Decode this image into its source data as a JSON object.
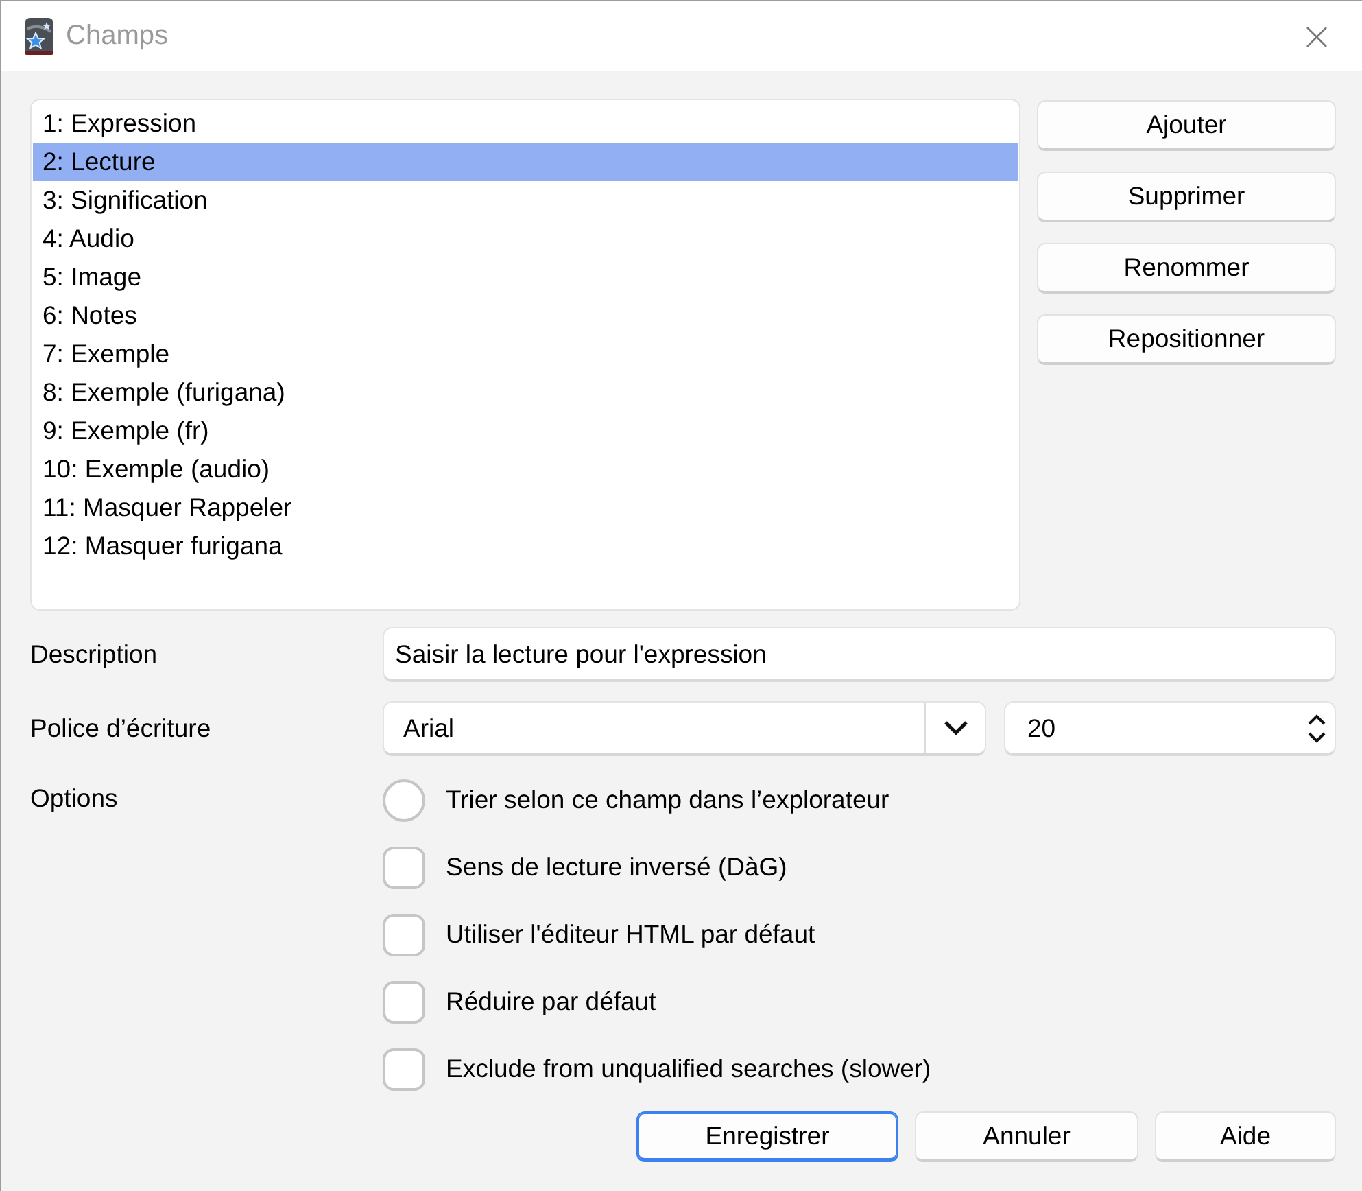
{
  "window": {
    "title": "Champs"
  },
  "fields": {
    "items": [
      {
        "label": "1: Expression",
        "selected": false
      },
      {
        "label": "2: Lecture",
        "selected": true
      },
      {
        "label": "3: Signification",
        "selected": false
      },
      {
        "label": "4: Audio",
        "selected": false
      },
      {
        "label": "5: Image",
        "selected": false
      },
      {
        "label": "6: Notes",
        "selected": false
      },
      {
        "label": "7: Exemple",
        "selected": false
      },
      {
        "label": "8: Exemple (furigana)",
        "selected": false
      },
      {
        "label": "9: Exemple (fr)",
        "selected": false
      },
      {
        "label": "10: Exemple (audio)",
        "selected": false
      },
      {
        "label": "11: Masquer Rappeler",
        "selected": false
      },
      {
        "label": "12: Masquer furigana",
        "selected": false
      }
    ]
  },
  "field_buttons": [
    "Ajouter",
    "Supprimer",
    "Renommer",
    "Repositionner"
  ],
  "description": {
    "label": "Description",
    "value": "Saisir la lecture pour l'expression"
  },
  "font": {
    "label": "Police d’écriture",
    "family": "Arial",
    "size": "20"
  },
  "options": {
    "label": "Options",
    "items": [
      {
        "kind": "radio",
        "label": "Trier selon ce champ dans l’explorateur",
        "checked": false
      },
      {
        "kind": "checkbox",
        "label": "Sens de lecture inversé (DàG)",
        "checked": false
      },
      {
        "kind": "checkbox",
        "label": "Utiliser l'éditeur HTML par défaut",
        "checked": false
      },
      {
        "kind": "checkbox",
        "label": "Réduire par défaut",
        "checked": false
      },
      {
        "kind": "checkbox",
        "label": "Exclude from unqualified searches (slower)",
        "checked": false
      }
    ]
  },
  "buttons": [
    {
      "label": "Enregistrer",
      "focused": true
    },
    {
      "label": "Annuler",
      "focused": false
    },
    {
      "label": "Aide",
      "focused": false
    }
  ]
}
